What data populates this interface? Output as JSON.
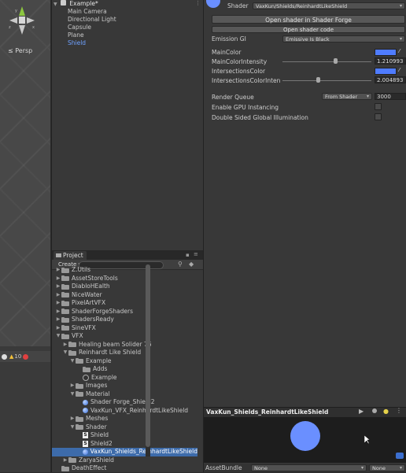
{
  "scene": {
    "persp_label": "≤ Persp",
    "console": {
      "info_count": "",
      "warn_count": "10",
      "err_count": ""
    }
  },
  "hierarchy": {
    "scene_name": "Example*",
    "items": [
      "Main Camera",
      "Directional Light",
      "Capsule",
      "Plane",
      "Shield"
    ]
  },
  "project": {
    "tab_label": "Project",
    "create_label": "Create ▾",
    "tree": [
      {
        "label": "Z.Utils",
        "icon": "folder",
        "indent": 1,
        "arrow": "▶"
      },
      {
        "label": "AssetStoreTools",
        "icon": "folder",
        "indent": 1,
        "arrow": "▶"
      },
      {
        "label": "DiabloHEalth",
        "icon": "folder",
        "indent": 1,
        "arrow": "▶"
      },
      {
        "label": "NiceWater",
        "icon": "folder",
        "indent": 1,
        "arrow": "▶"
      },
      {
        "label": "PixelArtVFX",
        "icon": "folder",
        "indent": 1,
        "arrow": "▶"
      },
      {
        "label": "ShaderForgeShaders",
        "icon": "folder",
        "indent": 1,
        "arrow": "▶"
      },
      {
        "label": "ShadersReady",
        "icon": "folder",
        "indent": 1,
        "arrow": "▶"
      },
      {
        "label": "SineVFX",
        "icon": "folder",
        "indent": 1,
        "arrow": "▶"
      },
      {
        "label": "VFX",
        "icon": "folder",
        "indent": 1,
        "arrow": "▼"
      },
      {
        "label": "Healing beam Solider 76",
        "icon": "folder",
        "indent": 2,
        "arrow": "▶"
      },
      {
        "label": "Reinhardt Like Shield",
        "icon": "folder",
        "indent": 2,
        "arrow": "▼"
      },
      {
        "label": "Example",
        "icon": "folder",
        "indent": 3,
        "arrow": "▼"
      },
      {
        "label": "Adds",
        "icon": "folder",
        "indent": 4,
        "arrow": ""
      },
      {
        "label": "Example",
        "icon": "scene",
        "indent": 4,
        "arrow": ""
      },
      {
        "label": "Images",
        "icon": "folder",
        "indent": 3,
        "arrow": "▶"
      },
      {
        "label": "Material",
        "icon": "folder",
        "indent": 3,
        "arrow": "▼"
      },
      {
        "label": "Shader Forge_Shield2",
        "icon": "material",
        "indent": 4,
        "arrow": ""
      },
      {
        "label": "VaxKun_VFX_ReinhardtLikeShield",
        "icon": "material",
        "indent": 4,
        "arrow": ""
      },
      {
        "label": "Meshes",
        "icon": "folder",
        "indent": 3,
        "arrow": "▶"
      },
      {
        "label": "Shader",
        "icon": "folder",
        "indent": 3,
        "arrow": "▼"
      },
      {
        "label": "Shield",
        "icon": "shader",
        "indent": 4,
        "arrow": ""
      },
      {
        "label": "Shield2",
        "icon": "shader",
        "indent": 4,
        "arrow": ""
      },
      {
        "label": "VaxKun_Shields_ReinhardtLikeShield",
        "icon": "material",
        "indent": 4,
        "arrow": "",
        "selected": true
      },
      {
        "label": "ZaryaShield",
        "icon": "folder",
        "indent": 2,
        "arrow": "▶"
      },
      {
        "label": "DeathEffect",
        "icon": "folder",
        "indent": 1,
        "arrow": ""
      }
    ]
  },
  "inspector": {
    "shader_label": "Shader",
    "shader_value": "VaxKun/Shields/ReinhardtLikeShield",
    "open_forge_label": "Open shader in Shader Forge",
    "open_code_label": "Open shader code",
    "emission_label": "Emission GI",
    "emission_value": "Emissive Is Black",
    "main_color_label": "MainColor",
    "main_color_intensity_label": "MainColorIntensity",
    "main_color_intensity_value": "1.210993",
    "intersections_color_label": "IntersectionsColor",
    "intersections_intensity_label": "IntersectionsColorInten",
    "intersections_intensity_value": "2.004893",
    "render_queue_label": "Render Queue",
    "render_queue_mode": "From Shader",
    "render_queue_value": "3000",
    "gpu_instancing_label": "Enable GPU Instancing",
    "double_sided_label": "Double Sided Global Illumination",
    "preview_title": "VaxKun_Shields_ReinhardtLikeShield",
    "assetbundle_label": "AssetBundle",
    "assetbundle_value": "None",
    "assetbundle_variant": "None",
    "colors": {
      "swatch": "#4f7cff",
      "preview_sphere": "#6a8fff",
      "selection": "#3d6baa"
    }
  }
}
